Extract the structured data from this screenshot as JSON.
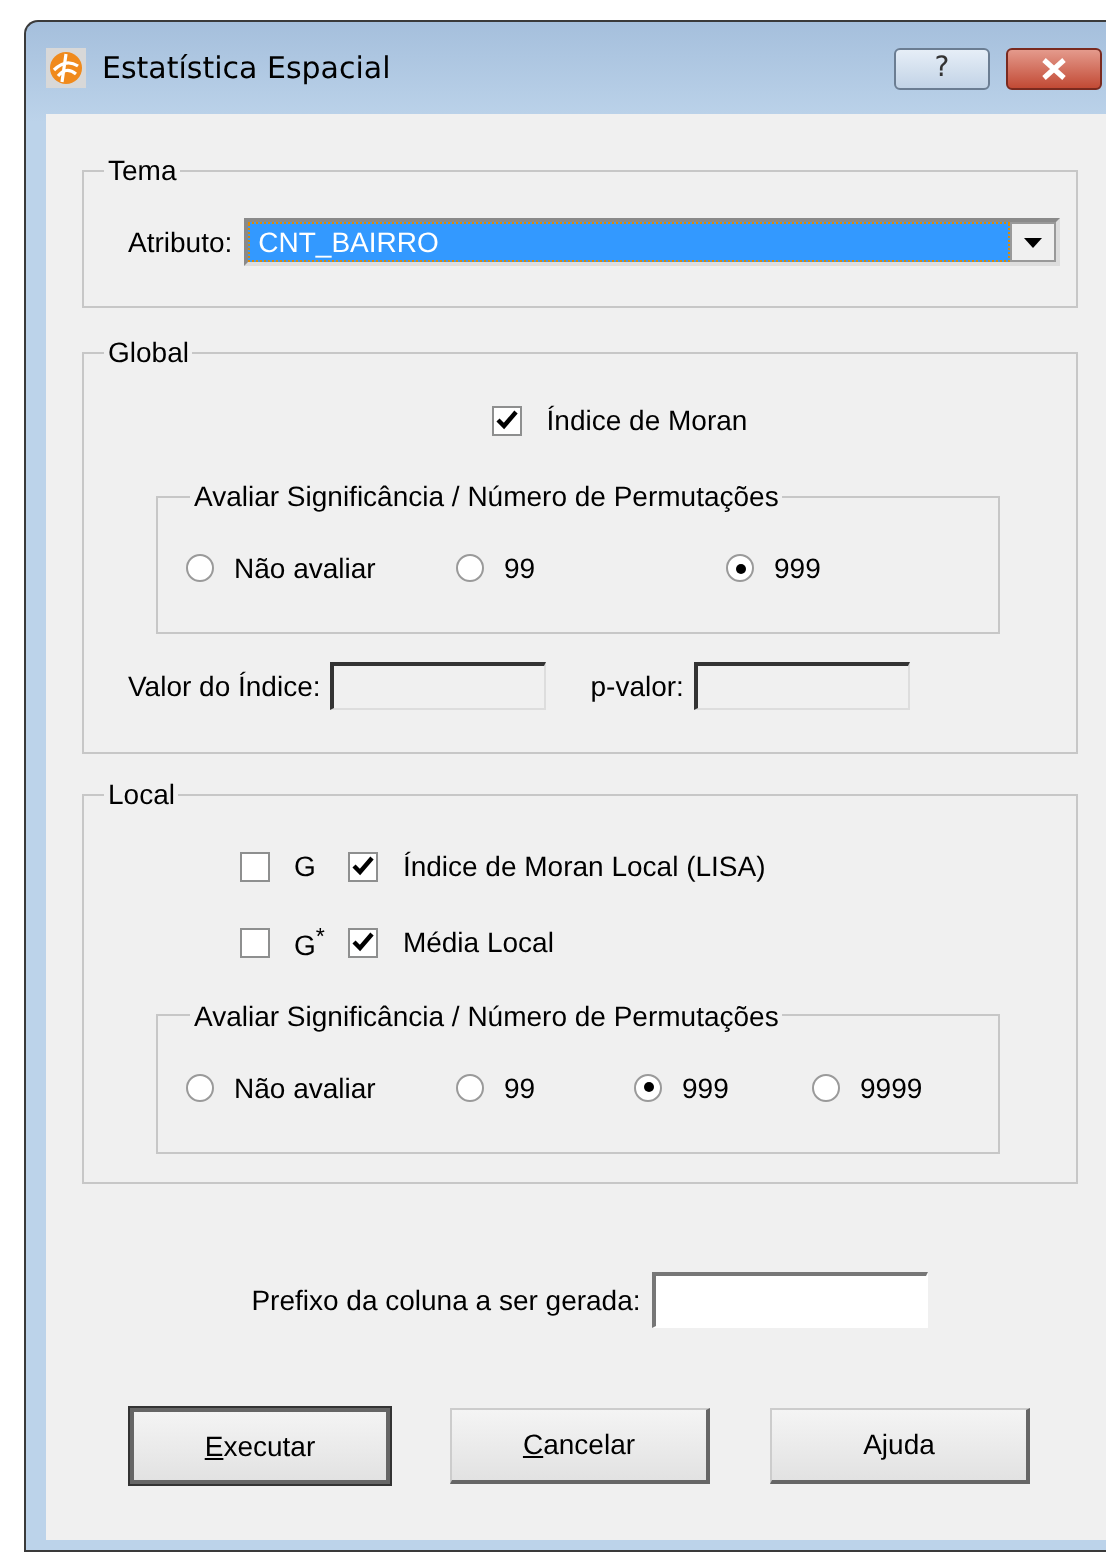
{
  "window": {
    "title": "Estatística Espacial",
    "help_button": "?"
  },
  "tema": {
    "legend": "Tema",
    "label": "Atributo:",
    "value": "CNT_BAIRRO",
    "focused": true
  },
  "global": {
    "legend": "Global",
    "moran": {
      "label": "Índice de Moran",
      "checked": true
    },
    "significance": {
      "legend": "Avaliar Significância / Número de Permutações",
      "options": [
        {
          "label": "Não avaliar",
          "selected": false
        },
        {
          "label": "99",
          "selected": false
        },
        {
          "label": "999",
          "selected": true
        }
      ]
    },
    "index_label": "Valor do Índice:",
    "p_label": "p-valor:"
  },
  "local": {
    "legend": "Local",
    "checks": [
      {
        "label": "G",
        "checked": false
      },
      {
        "label": "Índice de Moran Local (LISA)",
        "checked": true
      },
      {
        "label": "G$^{*}$",
        "checked": false
      },
      {
        "label": "Média Local",
        "checked": true
      }
    ],
    "significance": {
      "legend": "Avaliar Significância / Número de Permutações",
      "options": [
        {
          "label": "Não avaliar",
          "selected": false
        },
        {
          "label": "99",
          "selected": false
        },
        {
          "label": "999",
          "selected": true
        },
        {
          "label": "9999",
          "selected": false
        }
      ]
    }
  },
  "prefix_label": "Prefixo da coluna a ser gerada:",
  "buttons": [
    {
      "label": "Executar",
      "underline_first": true,
      "default": true
    },
    {
      "label": "Cancelar",
      "underline_first": true,
      "default": false
    },
    {
      "label": "Ajuda",
      "underline_first": false,
      "default": false
    }
  ]
}
